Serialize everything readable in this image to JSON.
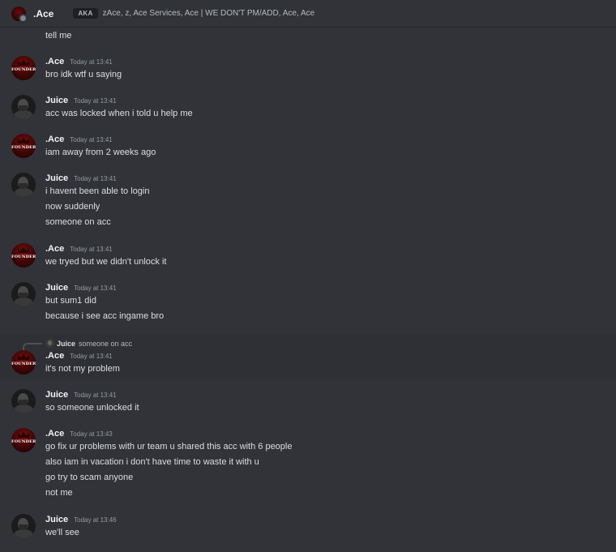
{
  "header": {
    "name": ".Ace",
    "aka_label": "AKA",
    "aka_names": "zAce, z, Ace Services, Ace | WE DON'T PM/ADD, Ace, Ace"
  },
  "top_line": "tell me",
  "messages": [
    {
      "author": ".Ace",
      "time": "Today at 13:41",
      "avatar": "founder-avatar",
      "lines": [
        "bro idk wtf u saying"
      ]
    },
    {
      "author": "Juice",
      "time": "Today at 13:41",
      "avatar": "juice-avatar",
      "lines": [
        "acc was locked when i told u help me"
      ]
    },
    {
      "author": ".Ace",
      "time": "Today at 13:41",
      "avatar": "founder-avatar",
      "lines": [
        "iam away from 2 weeks ago"
      ]
    },
    {
      "author": "Juice",
      "time": "Today at 13:41",
      "avatar": "juice-avatar",
      "lines": [
        "i havent been able to login",
        "now suddenly",
        "someone on acc"
      ]
    },
    {
      "author": ".Ace",
      "time": "Today at 13:41",
      "avatar": "founder-avatar",
      "lines": [
        "we tryed but we didn't unlock it"
      ]
    },
    {
      "author": "Juice",
      "time": "Today at 13:41",
      "avatar": "juice-avatar",
      "lines": [
        "but sum1 did",
        "because i see acc ingame bro"
      ]
    },
    {
      "author": ".Ace",
      "time": "Today at 13:41",
      "avatar": "founder-avatar",
      "lines": [
        "it's not my problem"
      ],
      "reply": {
        "author": "Juice",
        "text": "someone on acc"
      }
    },
    {
      "author": "Juice",
      "time": "Today at 13:41",
      "avatar": "juice-avatar",
      "lines": [
        "so someone unlocked it"
      ]
    },
    {
      "author": ".Ace",
      "time": "Today at 13:43",
      "avatar": "founder-avatar",
      "lines": [
        "go fix ur problems with ur team u shared this acc with 6 people",
        "also iam in vacation i don't have time to waste it with u",
        "go try to scam anyone",
        "not me"
      ]
    },
    {
      "author": "Juice",
      "time": "Today at 13:46",
      "avatar": "juice-avatar",
      "lines": [
        "we'll see"
      ]
    }
  ],
  "avatar_text": "FOUNDER",
  "colors": {
    "background": "#313338",
    "text": "#dbdee1",
    "timestamp": "#949ba4",
    "founder_red": "#7a0e0e"
  }
}
